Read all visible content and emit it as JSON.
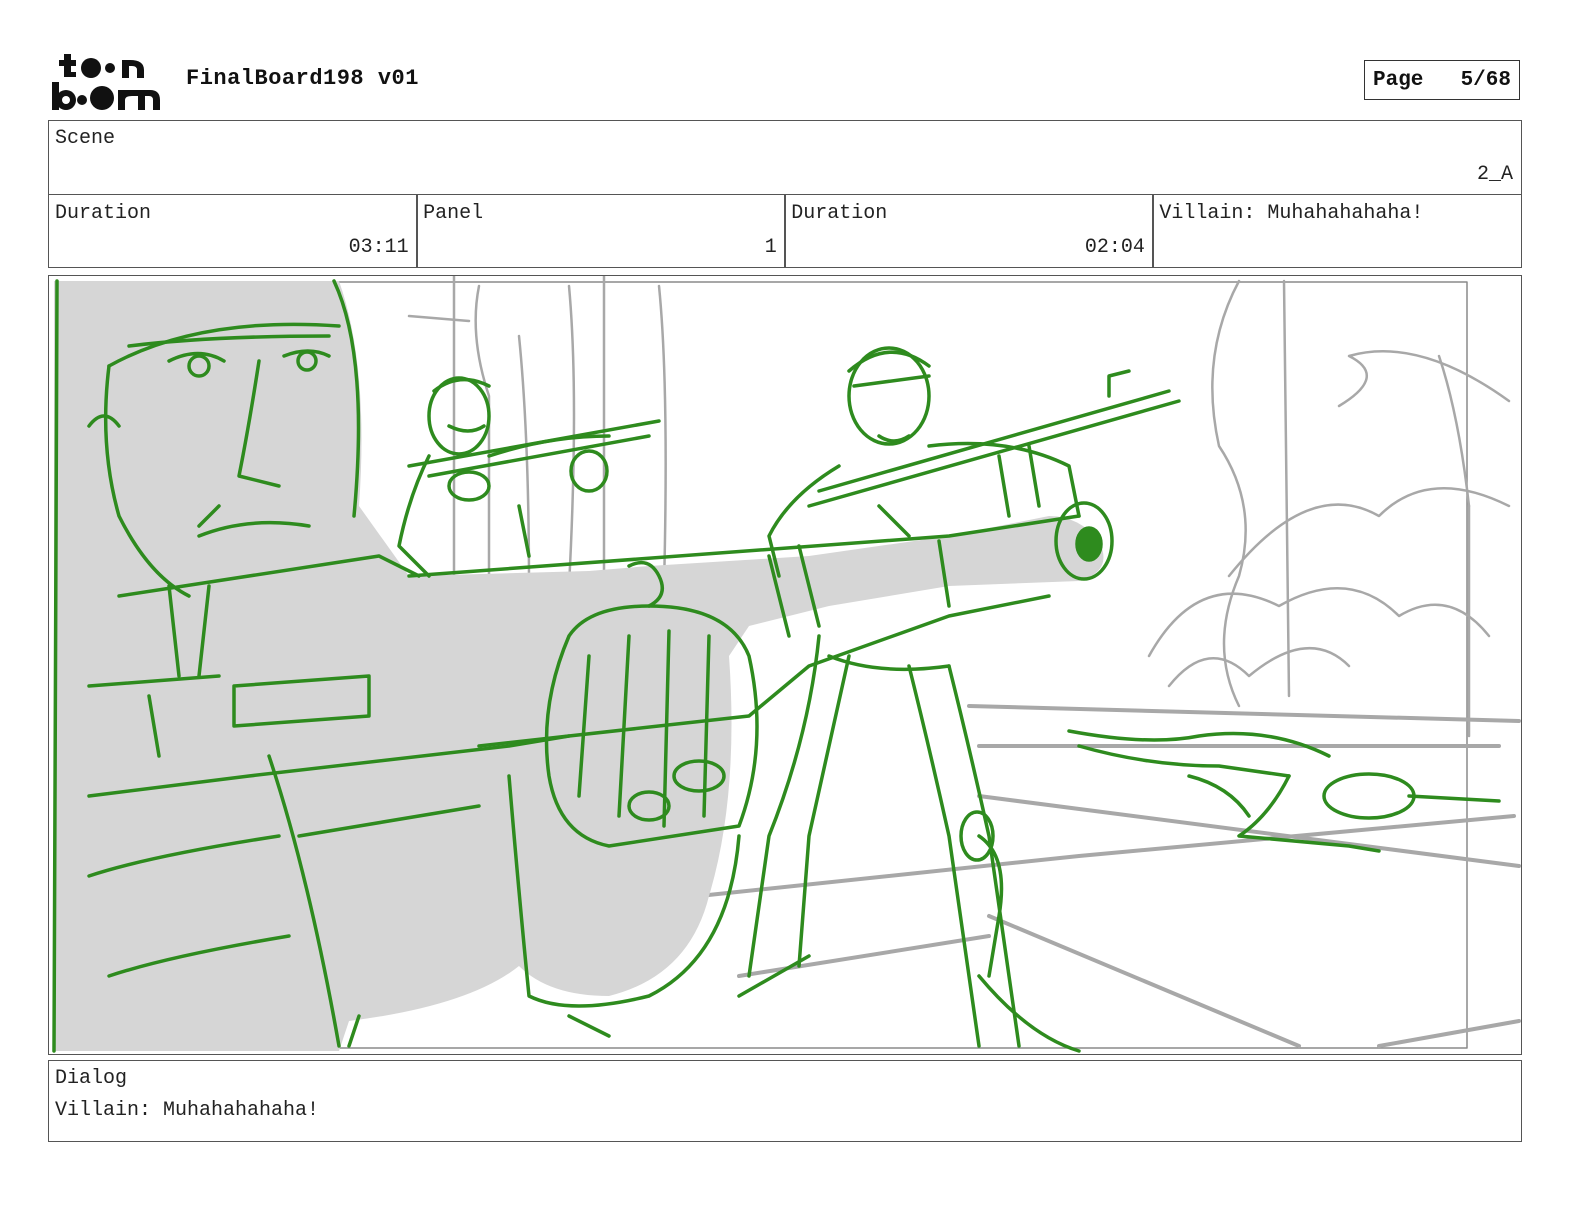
{
  "header": {
    "logo_text": "toon boom",
    "title": "FinalBoard198 v01",
    "page_label": "Page",
    "page_value": "5/68"
  },
  "scene": {
    "label": "Scene",
    "value": "2_A"
  },
  "info": {
    "duration_label": "Duration",
    "duration_value": "03:11",
    "panel_label": "Panel",
    "panel_value": "1",
    "panel_duration_label": "Duration",
    "panel_duration_value": "02:04",
    "action_note": "Villain: Muhahahahaha!"
  },
  "dialog": {
    "label": "Dialog",
    "text": "Villain: Muhahahahaha!"
  },
  "colors": {
    "sketch_green": "#2e8b1e",
    "sketch_gray": "#a8a8a8",
    "fill_gray": "#d6d6d6"
  }
}
